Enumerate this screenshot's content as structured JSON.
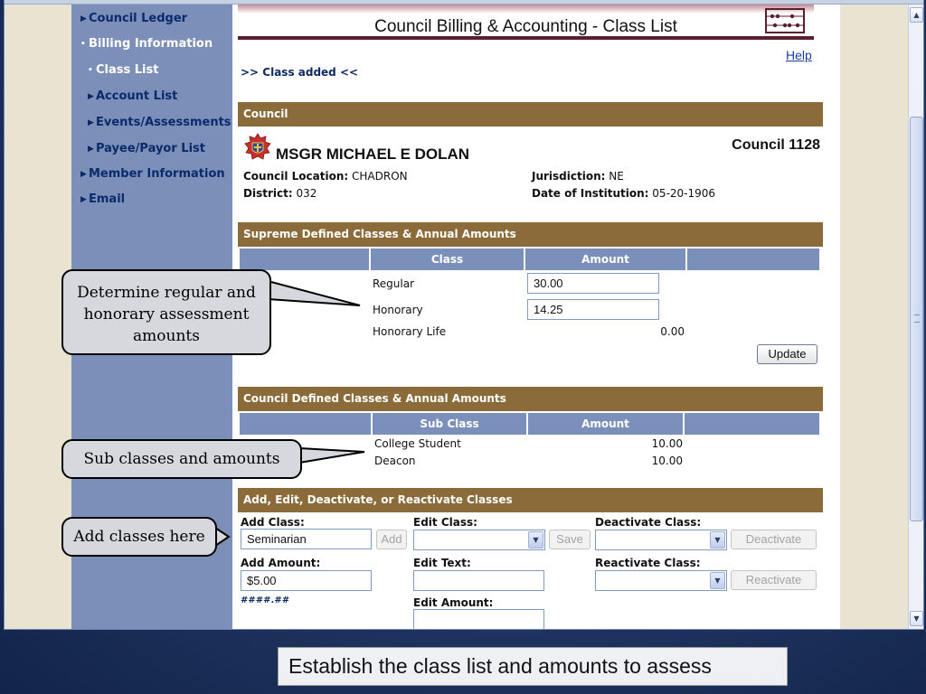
{
  "sidebar": {
    "items": [
      {
        "label": "Council Ledger",
        "marker": "▶"
      },
      {
        "label": "Billing Information",
        "marker": "•"
      },
      {
        "label": "Class List",
        "marker": "•"
      },
      {
        "label": "Account List",
        "marker": "▶"
      },
      {
        "label": "Events/Assessments",
        "marker": "▶"
      },
      {
        "label": "Payee/Payor List",
        "marker": "▶"
      },
      {
        "label": "Member Information",
        "marker": "▶"
      },
      {
        "label": "Email",
        "marker": "▶"
      }
    ]
  },
  "header": {
    "title": "Council Billing & Accounting - Class List",
    "help": "Help",
    "status": ">> Class added <<"
  },
  "council": {
    "section_title": "Council",
    "name": "MSGR MICHAEL E DOLAN",
    "number": "Council 1128",
    "location_label": "Council Location:",
    "location": "CHADRON",
    "district_label": "District:",
    "district": "032",
    "jurisdiction_label": "Jurisdiction:",
    "jurisdiction": "NE",
    "institution_label": "Date of Institution:",
    "institution": "05-20-1906"
  },
  "supreme": {
    "section_title": "Supreme Defined Classes & Annual Amounts",
    "col_class": "Class",
    "col_amount": "Amount",
    "rows": [
      {
        "class": "Regular",
        "amount": "30.00"
      },
      {
        "class": "Honorary",
        "amount": "14.25"
      },
      {
        "class": "Honorary Life",
        "amount": "0.00"
      }
    ],
    "update_button": "Update"
  },
  "council_classes": {
    "section_title": "Council Defined Classes & Annual Amounts",
    "col_subclass": "Sub Class",
    "col_amount": "Amount",
    "rows": [
      {
        "subclass": "College Student",
        "amount": "10.00"
      },
      {
        "subclass": "Deacon",
        "amount": "10.00"
      }
    ]
  },
  "manage": {
    "section_title": "Add, Edit, Deactivate, or Reactivate Classes",
    "add_class_label": "Add Class:",
    "add_class_value": "Seminarian",
    "add_button": "Add",
    "add_amount_label": "Add Amount:",
    "add_amount_value": "$5.00",
    "amount_format_hint": "####.##",
    "edit_class_label": "Edit Class:",
    "save_button": "Save",
    "edit_text_label": "Edit Text:",
    "edit_amount_label": "Edit Amount:",
    "deactivate_label": "Deactivate Class:",
    "deactivate_button": "Deactivate",
    "reactivate_label": "Reactivate Class:",
    "reactivate_button": "Reactivate"
  },
  "callouts": {
    "assessment": [
      "Determine regular and",
      "honorary assessment",
      "amounts"
    ],
    "subclasses": "Sub classes and amounts",
    "add_classes": "Add classes here"
  },
  "caption": "Establish the class list and amounts to assess",
  "colors": {
    "section_header": "#8c6b3a",
    "table_header": "#7a8fba",
    "sidebar": "#7c8fb8",
    "banner_rule": "#5a1f2e",
    "link": "#1a3fa0"
  }
}
